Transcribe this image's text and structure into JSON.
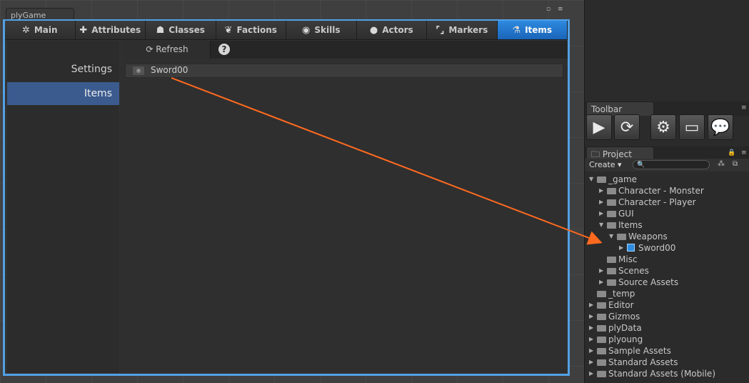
{
  "ply_window": {
    "title": "plyGame",
    "controls": [
      "▫",
      "≡"
    ],
    "tabs": [
      {
        "label": "Main",
        "icon": "gear-icon",
        "glyph": "✲"
      },
      {
        "label": "Attributes",
        "icon": "plus-icon",
        "glyph": "✚"
      },
      {
        "label": "Classes",
        "icon": "helmet-icon",
        "glyph": "☗"
      },
      {
        "label": "Factions",
        "icon": "wings-icon",
        "glyph": "❦"
      },
      {
        "label": "Skills",
        "icon": "skill-icon",
        "glyph": "◉"
      },
      {
        "label": "Actors",
        "icon": "head-icon",
        "glyph": "●"
      },
      {
        "label": "Markers",
        "icon": "markers-icon",
        "glyph": "⌜⌟"
      },
      {
        "label": "Items",
        "icon": "flask-icon",
        "glyph": "⚗"
      }
    ],
    "active_tab": "Items",
    "sidebar": [
      {
        "label": "Settings",
        "active": false
      },
      {
        "label": "Items",
        "active": true
      }
    ],
    "toolbar": {
      "refresh_label": "Refresh",
      "refresh_glyph": "⟳",
      "help_glyph": "?"
    },
    "items": [
      {
        "label": "Sword00"
      }
    ]
  },
  "toolbar_panel": {
    "title": "Toolbar",
    "buttons": [
      {
        "name": "play-icon",
        "glyph": "▶"
      },
      {
        "name": "refresh-icon",
        "glyph": "⟳"
      },
      {
        "name": "gear-icon",
        "glyph": "⚙"
      },
      {
        "name": "monitor-icon",
        "glyph": "▭"
      },
      {
        "name": "chat-icon",
        "glyph": "💬"
      }
    ]
  },
  "project_panel": {
    "title": "Project",
    "create_label": "Create ▾",
    "search_placeholder": "🔍",
    "tree": [
      {
        "label": "_game",
        "depth": 0,
        "arrow": "▼",
        "kind": "folder"
      },
      {
        "label": "Character - Monster",
        "depth": 1,
        "arrow": "▶",
        "kind": "folder"
      },
      {
        "label": "Character - Player",
        "depth": 1,
        "arrow": "▶",
        "kind": "folder"
      },
      {
        "label": "GUI",
        "depth": 1,
        "arrow": "▶",
        "kind": "folder"
      },
      {
        "label": "Items",
        "depth": 1,
        "arrow": "▼",
        "kind": "folder"
      },
      {
        "label": "Weapons",
        "depth": 2,
        "arrow": "▼",
        "kind": "folder"
      },
      {
        "label": "Sword00",
        "depth": 3,
        "arrow": "▶",
        "kind": "prefab"
      },
      {
        "label": "Misc",
        "depth": 1,
        "arrow": "",
        "kind": "folder"
      },
      {
        "label": "Scenes",
        "depth": 1,
        "arrow": "▶",
        "kind": "folder"
      },
      {
        "label": "Source Assets",
        "depth": 1,
        "arrow": "▶",
        "kind": "folder"
      },
      {
        "label": "_temp",
        "depth": 0,
        "arrow": "",
        "kind": "folder"
      },
      {
        "label": "Editor",
        "depth": 0,
        "arrow": "▶",
        "kind": "folder"
      },
      {
        "label": "Gizmos",
        "depth": 0,
        "arrow": "▶",
        "kind": "folder"
      },
      {
        "label": "plyData",
        "depth": 0,
        "arrow": "▶",
        "kind": "folder"
      },
      {
        "label": "plyoung",
        "depth": 0,
        "arrow": "▶",
        "kind": "folder"
      },
      {
        "label": "Sample Assets",
        "depth": 0,
        "arrow": "▶",
        "kind": "folder"
      },
      {
        "label": "Standard Assets",
        "depth": 0,
        "arrow": "▶",
        "kind": "folder"
      },
      {
        "label": "Standard Assets (Mobile)",
        "depth": 0,
        "arrow": "▶",
        "kind": "folder"
      }
    ]
  },
  "colors": {
    "accent": "#52a0e6",
    "active_tab": "#1f74cc",
    "arrow": "#ff6a1f"
  }
}
